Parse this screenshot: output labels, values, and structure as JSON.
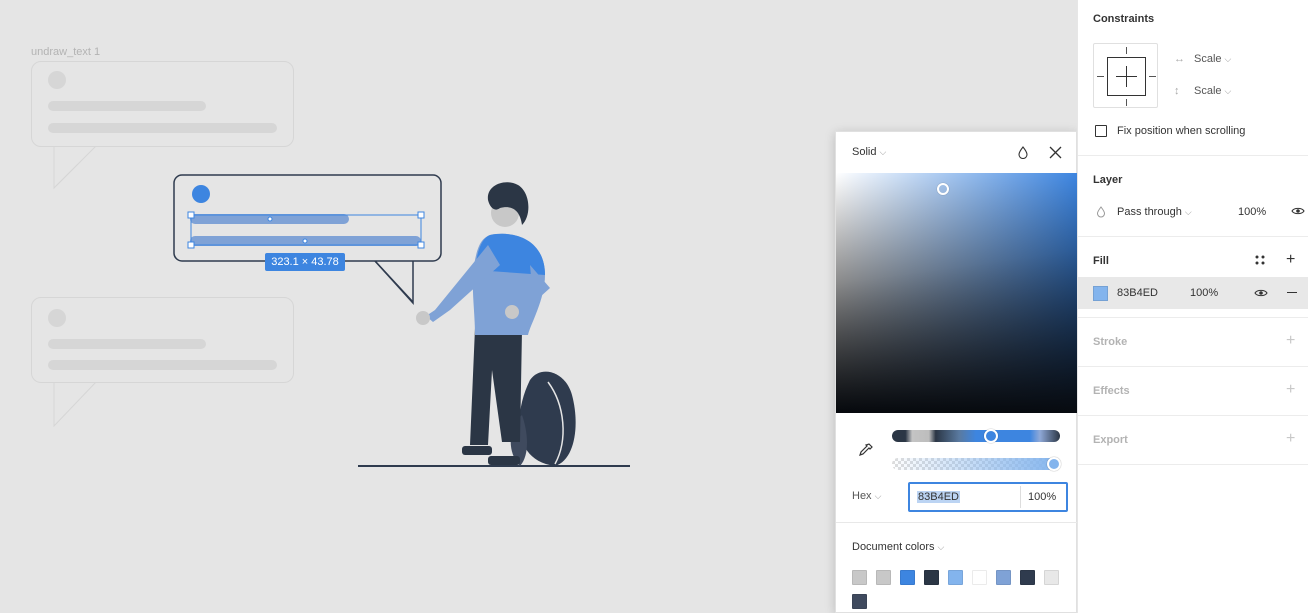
{
  "canvas": {
    "frame_label": "undraw_text 1",
    "dimension_label": "323.1 × 43.78"
  },
  "picker": {
    "mode": "Solid",
    "hex_label": "Hex",
    "hex_value": "83B4ED",
    "alpha_value": "100%",
    "document_colors_label": "Document colors",
    "document_colors": [
      "#c8c8c8",
      "#c8c8c8",
      "#3d85e0",
      "#2b3645",
      "#83b4ed",
      "#ffffff",
      "#7fa2d6",
      "#2f3b4e",
      "#e8e8e8",
      "#3f4a5e"
    ]
  },
  "panel": {
    "constraints": {
      "title": "Constraints",
      "horizontal": "Scale",
      "vertical": "Scale",
      "fix_position_label": "Fix position when scrolling"
    },
    "layer": {
      "title": "Layer",
      "blend_mode": "Pass through",
      "opacity": "100%"
    },
    "fill": {
      "title": "Fill",
      "hex": "83B4ED",
      "opacity": "100%",
      "color": "#83b4ed"
    },
    "stroke_title": "Stroke",
    "effects_title": "Effects",
    "export_title": "Export"
  },
  "colors": {
    "accent": "#3d85e0",
    "fill": "#83b4ed",
    "dark": "#2f3b4e"
  }
}
